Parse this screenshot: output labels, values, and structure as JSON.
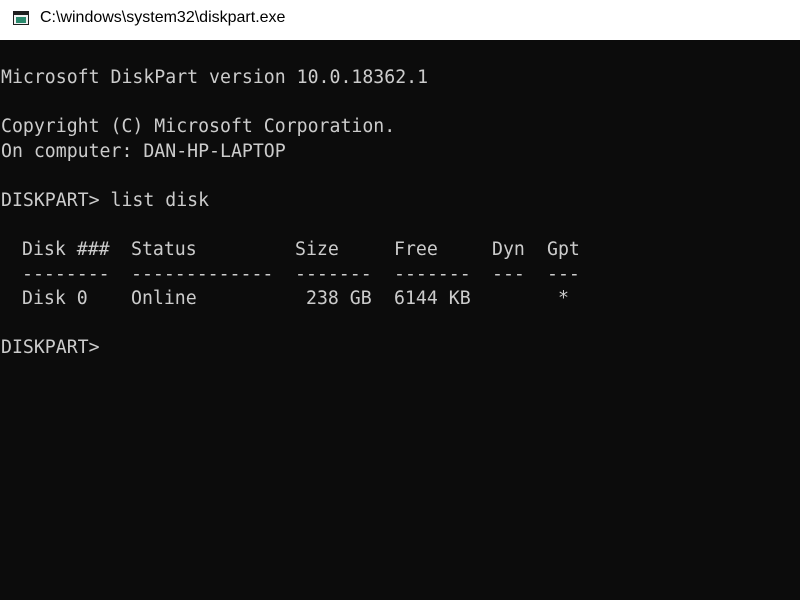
{
  "window": {
    "title": "C:\\windows\\system32\\diskpart.exe",
    "icon": "console-app-icon"
  },
  "colors": {
    "console_bg": "#0c0c0c",
    "console_fg": "#cccccc",
    "titlebar_bg": "#ffffff"
  },
  "console": {
    "version_line": "Microsoft DiskPart version 10.0.18362.1",
    "copyright_line": "Copyright (C) Microsoft Corporation.",
    "computer_line": "On computer: DAN-HP-LAPTOP",
    "command_line": "DISKPART> list disk",
    "table": {
      "headers": [
        "Disk ###",
        "Status",
        "Size",
        "Free",
        "Dyn",
        "Gpt"
      ],
      "separators": [
        "--------",
        "-------------",
        "-------",
        "-------",
        "---",
        "---"
      ],
      "rows": [
        [
          "Disk 0",
          "Online",
          "238 GB",
          "6144 KB",
          "",
          "*"
        ]
      ]
    },
    "prompt": "DISKPART>"
  }
}
